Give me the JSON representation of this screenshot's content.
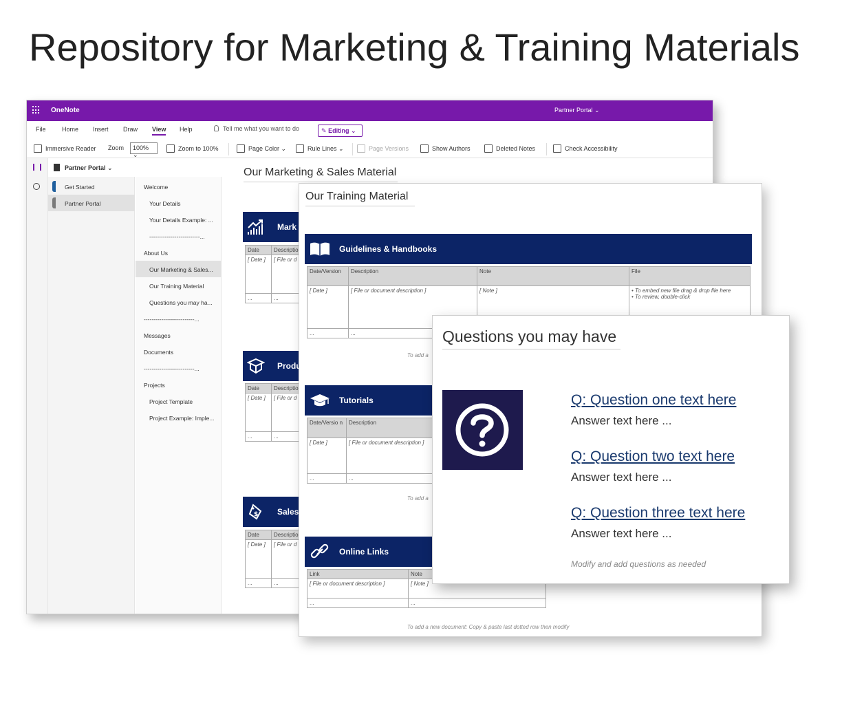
{
  "slide": {
    "title": "Repository for Marketing & Training Materials"
  },
  "onenote": {
    "app_name": "OneNote",
    "top_right": "Partner Portal ⌄",
    "menu": {
      "file": "File",
      "home": "Home",
      "insert": "Insert",
      "draw": "Draw",
      "view": "View",
      "help": "Help",
      "tell_me": "Tell me what you want to do",
      "editing": "Editing ⌄"
    },
    "toolbar": {
      "immersive_reader": "Immersive Reader",
      "zoom": "Zoom",
      "zoom_value": "100% ⌄",
      "zoom_to_100": "Zoom to 100%",
      "page_color": "Page Color ⌄",
      "rule_lines": "Rule Lines ⌄",
      "page_versions": "Page Versions",
      "show_authors": "Show Authors",
      "deleted_notes": "Deleted Notes",
      "check_accessibility": "Check Accessibility"
    },
    "notebook": "Partner Portal ⌄",
    "sections": [
      {
        "label": "Get Started",
        "color": "#1f5f9e"
      },
      {
        "label": "Partner Portal",
        "color": "#7a7a7a"
      }
    ],
    "pages": [
      "Welcome",
      "Your Details",
      "Your Details Example: ...",
      "--------------------------...",
      "About Us",
      "Our Marketing & Sales...",
      "Our Training Material",
      "Questions you may ha...",
      "--------------------------...",
      "Messages",
      "Documents",
      "--------------------------...",
      "Projects",
      "Project Template",
      "Project Example: Imple..."
    ],
    "marketing": {
      "title": "Our Marketing & Sales Material",
      "banners": [
        "Mark",
        "Produ",
        "Sales"
      ],
      "col_date": "Date",
      "col_desc": "Descriptio",
      "cell_date": "[ Date ]",
      "cell_desc": "[ File or d",
      "dots": "...",
      "hint": "To add a"
    }
  },
  "training": {
    "title": "Our Training Material",
    "guidelines": {
      "heading": "Guidelines & Handbooks",
      "headers": [
        "Date/Version",
        "Description",
        "Note",
        "File"
      ],
      "date": "[ Date ]",
      "desc": "[ File or document description ]",
      "note": "[ Note ]",
      "file_bullet1": "To embed new file drag & drop file here",
      "file_bullet2": "To review, double-click",
      "dots": "..."
    },
    "tutorials": {
      "heading": "Tutorials",
      "headers": [
        "Date/Versio n",
        "Description"
      ],
      "date": "[ Date ]",
      "desc": "[ File or document description ]",
      "dots": "..."
    },
    "online_links": {
      "heading": "Online Links",
      "headers": [
        "Link",
        "Note"
      ],
      "desc": "[ File or document description ]",
      "note": "[ Note ]",
      "dots": "..."
    },
    "hint_short": "To add a",
    "hint_full": "To add a new document: Copy & paste last dotted row then modify"
  },
  "questions": {
    "title": "Questions you may have",
    "items": [
      {
        "q": "Q: Question one text here",
        "a": "Answer text here ..."
      },
      {
        "q": "Q: Question two text here",
        "a": "Answer text here ..."
      },
      {
        "q": "Q: Question three text here",
        "a": "Answer text here ..."
      }
    ],
    "note": "Modify and add questions as needed"
  },
  "colors": {
    "onenote_purple": "#7719aa",
    "banner_navy": "#0c2466",
    "question_icon_bg": "#1e1a4d"
  }
}
